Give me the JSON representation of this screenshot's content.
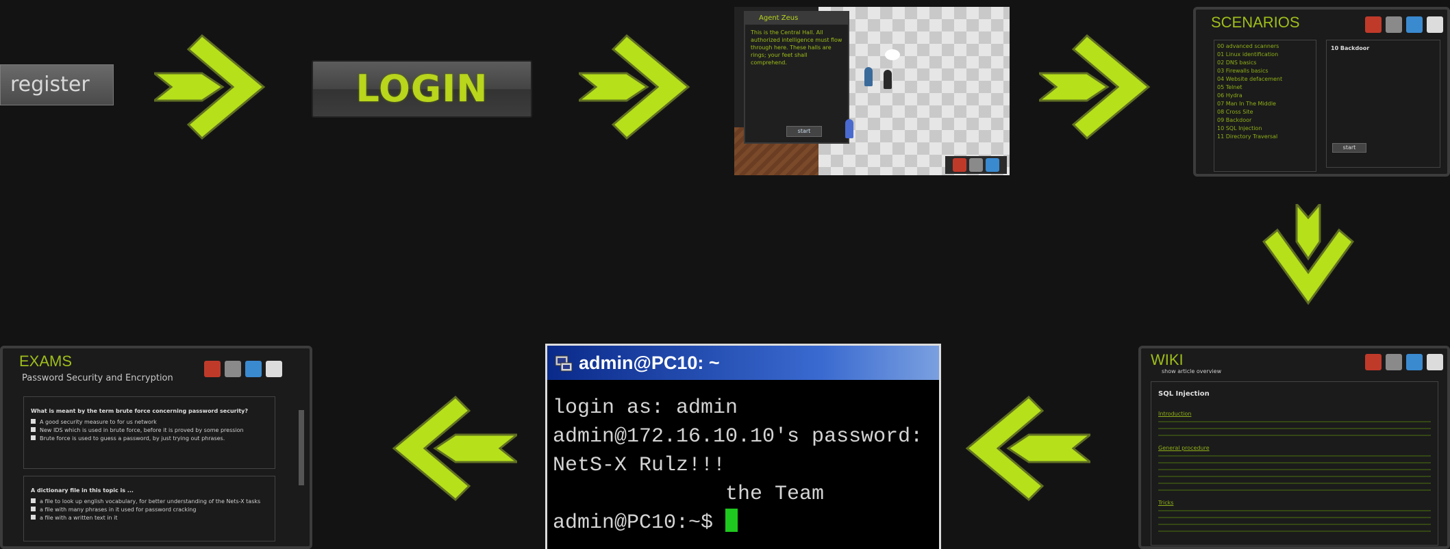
{
  "steps": {
    "register": {
      "label": "register"
    },
    "login": {
      "label": "LOGIN"
    },
    "game": {
      "popup_title": "Agent Zeus",
      "popup_text": "This is the Central Hall. All authorized intelligence must flow through here. These halls are rings; your feet shall comprehend.",
      "popup_button": "start"
    },
    "scenarios": {
      "title": "SCENARIOS",
      "items": [
        "00  advanced scanners",
        "01  Linux identification",
        "02  DNS basics",
        "03  Firewalls basics",
        "04  Website defacement",
        "05  Telnet",
        "06  Hydra",
        "07  Man In The Middle",
        "08  Cross Site",
        "09  Backdoor",
        "10  SQL Injection",
        "11  Directory Traversal"
      ],
      "detail_title": "10  Backdoor",
      "detail_button": "start"
    },
    "wiki": {
      "title": "WIKI",
      "subtitle": "show article overview",
      "heading": "SQL Injection",
      "sections": [
        "Introduction",
        "General procedure",
        "Tricks"
      ]
    },
    "terminal": {
      "title": "admin@PC10: ~",
      "lines": [
        "login as: admin",
        "admin@172.16.10.10's password:",
        "NetS-X Rulz!!!",
        "              the Team",
        "admin@PC10:~$ "
      ]
    },
    "exams": {
      "title": "EXAMS",
      "subtitle": "Password Security and Encryption",
      "q1_title": "What is meant by the term brute force concerning password security?",
      "q1_options": [
        "A good security measure to for us network",
        "New IDS which is used in brute force, before it is proved by some pression",
        "Brute force is used to guess a password, by just trying out phrases."
      ],
      "q2_title": "A dictionary file in this topic is ...",
      "q2_options": [
        "a file to look up english vocabulary, for better understanding of the Nets-X tasks",
        "a file with many phrases in it used for password cracking",
        "a file with a written text in it"
      ]
    }
  },
  "colors": {
    "accent": "#b6e01a",
    "background": "#141314"
  }
}
